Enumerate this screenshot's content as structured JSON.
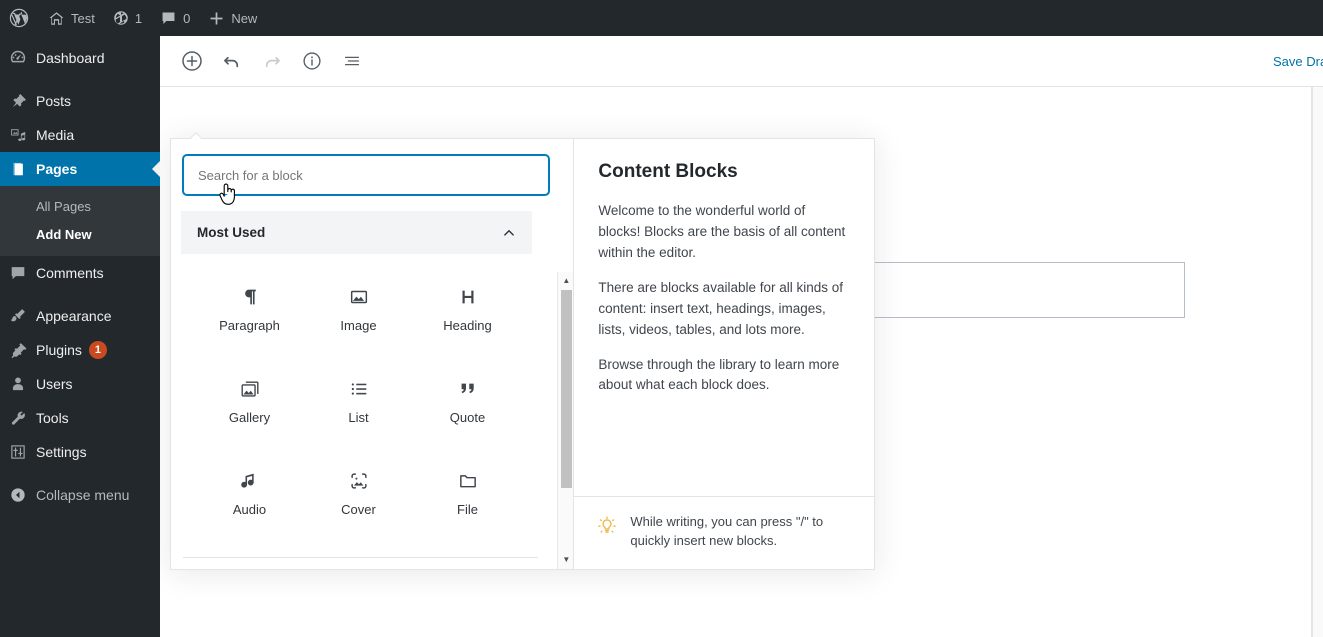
{
  "adminbar": {
    "logo_icon": "wordpress-logo-icon",
    "items": [
      {
        "icon": "home-icon",
        "label": "Test"
      },
      {
        "icon": "updates-icon",
        "label": "1"
      },
      {
        "icon": "comment-bubble-icon",
        "label": "0"
      },
      {
        "icon": "plus-icon",
        "label": "New"
      }
    ]
  },
  "sidebar": {
    "items": [
      {
        "icon": "dashboard-icon",
        "label": "Dashboard",
        "current": false
      },
      {
        "icon": "posts-pin-icon",
        "label": "Posts",
        "current": false
      },
      {
        "icon": "media-icon",
        "label": "Media",
        "current": false
      },
      {
        "icon": "pages-icon",
        "label": "Pages",
        "current": true
      },
      {
        "icon": "comments-icon",
        "label": "Comments",
        "current": false
      },
      {
        "icon": "appearance-brush-icon",
        "label": "Appearance",
        "current": false
      },
      {
        "icon": "plugins-plug-icon",
        "label": "Plugins",
        "current": false,
        "badge": "1"
      },
      {
        "icon": "users-icon",
        "label": "Users",
        "current": false
      },
      {
        "icon": "tools-wrench-icon",
        "label": "Tools",
        "current": false
      },
      {
        "icon": "settings-sliders-icon",
        "label": "Settings",
        "current": false
      }
    ],
    "submenu": [
      {
        "label": "All Pages",
        "current": false
      },
      {
        "label": "Add New",
        "current": true
      }
    ],
    "collapse": {
      "icon": "collapse-arrow-icon",
      "label": "Collapse menu"
    },
    "accent_color": "#0073aa",
    "badge_color": "#ca4a1f"
  },
  "editor": {
    "toolbar": {
      "add_block_label": "Add block",
      "undo_label": "Undo",
      "redo_label": "Redo",
      "info_label": "Content structure",
      "list_view_label": "Block navigation"
    },
    "save_draft_label": "Save Draf",
    "save_draft_color": "#0073aa"
  },
  "inserter": {
    "search": {
      "placeholder": "Search for a block",
      "value": "",
      "focus_color": "#007cba"
    },
    "panel": {
      "title": "Most Used",
      "collapse_icon": "chevron-up-icon",
      "expanded": true
    },
    "blocks": [
      {
        "icon": "paragraph-icon",
        "label": "Paragraph"
      },
      {
        "icon": "image-icon",
        "label": "Image"
      },
      {
        "icon": "heading-icon",
        "label": "Heading"
      },
      {
        "icon": "gallery-icon",
        "label": "Gallery"
      },
      {
        "icon": "list-icon",
        "label": "List"
      },
      {
        "icon": "quote-icon",
        "label": "Quote"
      },
      {
        "icon": "audio-icon",
        "label": "Audio"
      },
      {
        "icon": "cover-icon",
        "label": "Cover"
      },
      {
        "icon": "file-icon",
        "label": "File"
      }
    ],
    "help": {
      "title": "Content Blocks",
      "paragraphs": [
        "Welcome to the wonderful world of blocks! Blocks are the basis of all content within the editor.",
        "There are blocks available for all kinds of content: insert text, headings, images, lists, videos, tables, and lots more.",
        "Browse through the library to learn more about what each block does."
      ],
      "tip_icon": "lightbulb-icon",
      "tip_text": "While writing, you can press \"/\" to quickly insert new blocks.",
      "tip_color": "#f0b849"
    }
  },
  "cursor": {
    "icon": "pointing-hand-cursor"
  }
}
